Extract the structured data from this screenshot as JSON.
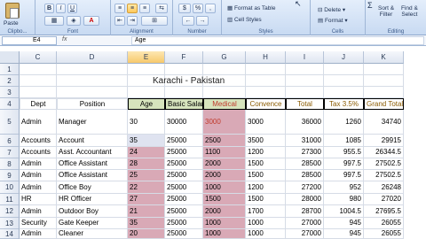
{
  "ribbon": {
    "clipboard": {
      "paste_label": "Paste",
      "group_label": "Clipbo..."
    },
    "font": {
      "bold": "B",
      "italic": "I",
      "underline": "U",
      "group_label": "Font"
    },
    "alignment": {
      "group_label": "Alignment"
    },
    "number": {
      "currency": "$",
      "percent": "%",
      "comma": ",",
      "group_label": "Number"
    },
    "styles": {
      "format_as_table": "Format as Table",
      "cell_styles": "Cell Styles",
      "group_label": "Styles"
    },
    "cells": {
      "delete": "Delete",
      "format": "Format",
      "group_label": "Cells"
    },
    "editing": {
      "sort_filter": "Sort &",
      "sort_filter2": "Filter",
      "find_select": "Find &",
      "find_select2": "Select",
      "group_label": "Editing"
    }
  },
  "formula_bar": {
    "name_box": "E4",
    "fx": "fx",
    "content": "Age"
  },
  "columns": [
    "C",
    "D",
    "E",
    "F",
    "G",
    "H",
    "I",
    "J",
    "K"
  ],
  "rows": [
    "1",
    "2",
    "3",
    "4",
    "5",
    "6",
    "7",
    "8",
    "9",
    "10",
    "11",
    "12",
    "13",
    "14"
  ],
  "sheet": {
    "title": "Karachi - Pakistan",
    "headers": [
      "Dept",
      "Position",
      "Age",
      "Basic Salary",
      "Medical",
      "Convence",
      "Total",
      "Tax 3.5%",
      "Grand Total"
    ],
    "data": [
      [
        "Admin",
        "Manager",
        "30",
        "30000",
        "3000",
        "3000",
        "36000",
        "1260",
        "34740"
      ],
      [
        "Accounts",
        "Account",
        "35",
        "25000",
        "2500",
        "3500",
        "31000",
        "1085",
        "29915"
      ],
      [
        "Accounts",
        "Asst. Accountant",
        "24",
        "25000",
        "1100",
        "1200",
        "27300",
        "955.5",
        "26344.5"
      ],
      [
        "Admin",
        "Office Assistant",
        "28",
        "25000",
        "2000",
        "1500",
        "28500",
        "997.5",
        "27502.5"
      ],
      [
        "Admin",
        "Office Assistant",
        "25",
        "25000",
        "2000",
        "1500",
        "28500",
        "997.5",
        "27502.5"
      ],
      [
        "Admin",
        "Office Boy",
        "22",
        "25000",
        "1000",
        "1200",
        "27200",
        "952",
        "26248"
      ],
      [
        "HR",
        "HR Officer",
        "27",
        "25000",
        "1500",
        "1500",
        "28000",
        "980",
        "27020"
      ],
      [
        "Admin",
        "Outdoor Boy",
        "21",
        "25000",
        "2000",
        "1700",
        "28700",
        "1004.5",
        "27695.5"
      ],
      [
        "Security",
        "Gate Keeper",
        "35",
        "25000",
        "1000",
        "1000",
        "27000",
        "945",
        "26055"
      ],
      [
        "Admin",
        "Cleaner",
        "20",
        "25000",
        "1000",
        "1000",
        "27000",
        "945",
        "26055"
      ]
    ]
  },
  "colors": {
    "age_fill": "#dfe3f0",
    "medical_fill": "#d9a9b6",
    "header_fill": "#d7e4bd"
  }
}
